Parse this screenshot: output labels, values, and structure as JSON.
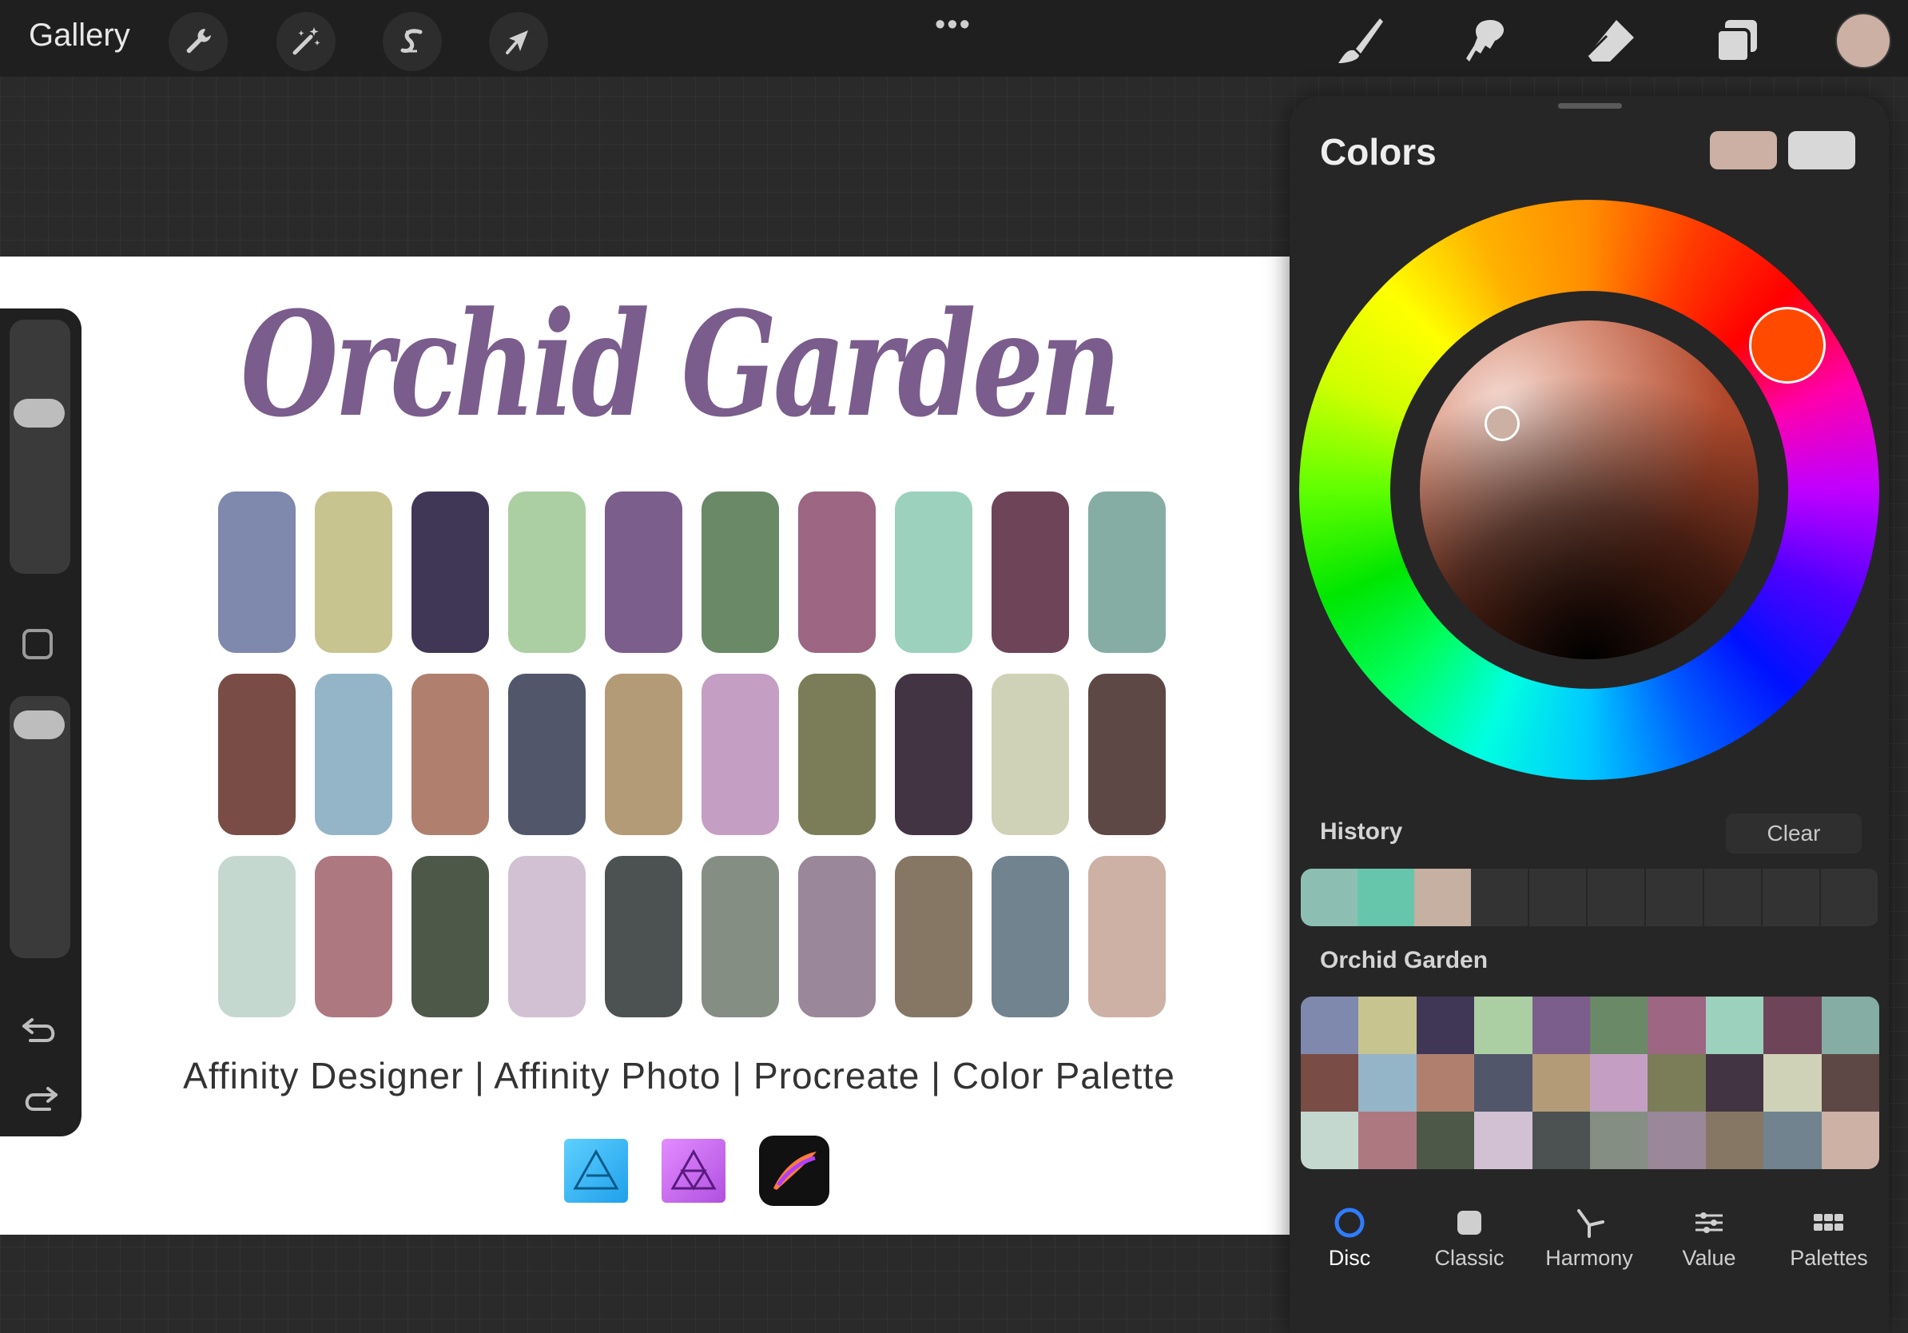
{
  "topbar": {
    "gallery_label": "Gallery",
    "tools_left": [
      "wrench-icon",
      "magic-wand-icon",
      "selection-s-icon",
      "transform-arrow-icon"
    ],
    "more_label": "•••",
    "tools_right": [
      "brush-icon",
      "smudge-icon",
      "eraser-icon",
      "layers-icon"
    ],
    "current_color": "#cbb0a3"
  },
  "canvas": {
    "title": "Orchid Garden",
    "title_color": "#7a5d8c",
    "swatch_rows": [
      [
        "#7f89ad",
        "#c7c490",
        "#403656",
        "#abcfa3",
        "#7b5e8b",
        "#698967",
        "#9d6683",
        "#9cd1bd",
        "#6e4558",
        "#85ada4"
      ],
      [
        "#794c46",
        "#94b5c7",
        "#b07f6e",
        "#51566a",
        "#b39b77",
        "#c49fc3",
        "#7b7d58",
        "#433443",
        "#d0d2b7",
        "#5d4846"
      ],
      [
        "#c5d8d0",
        "#ae7881",
        "#4d5849",
        "#d1c1d2",
        "#4c5251",
        "#848e83",
        "#9a8799",
        "#867765",
        "#70838e",
        "#cdb1a5"
      ]
    ],
    "tagline": "Affinity Designer | Affinity Photo | Procreate | Color Palette",
    "app_icons": [
      "affinity-designer-logo",
      "affinity-photo-logo",
      "procreate-logo"
    ]
  },
  "sidebar": {
    "brush_size_level": 0.28,
    "opacity_level": 0.92
  },
  "colors_panel": {
    "title": "Colors",
    "primary_color": "#cbb0a3",
    "secondary_color": "#d8d8d8",
    "hue_color": "#ff4a00",
    "history_label": "History",
    "clear_label": "Clear",
    "history_colors": [
      "#8cbfb2",
      "#66c6ac",
      "#c5b0a1"
    ],
    "history_empty_slots": 7,
    "palette_name": "Orchid Garden",
    "palette_colors": [
      "#7f89ad",
      "#c7c490",
      "#403656",
      "#abcfa3",
      "#7b5e8b",
      "#698967",
      "#9d6683",
      "#9cd1bd",
      "#6e4558",
      "#85ada4",
      "#794c46",
      "#94b5c7",
      "#b07f6e",
      "#51566a",
      "#b39b77",
      "#c49fc3",
      "#7b7d58",
      "#433443",
      "#d0d2b7",
      "#5d4846",
      "#c5d8d0",
      "#ae7881",
      "#4d5849",
      "#d1c1d2",
      "#4c5251",
      "#848e83",
      "#9a8799",
      "#867765",
      "#70838e",
      "#cdb1a5"
    ],
    "tabs": [
      {
        "label": "Disc",
        "icon": "disc-icon",
        "active": true
      },
      {
        "label": "Classic",
        "icon": "classic-square-icon",
        "active": false
      },
      {
        "label": "Harmony",
        "icon": "harmony-icon",
        "active": false
      },
      {
        "label": "Value",
        "icon": "sliders-icon",
        "active": false
      },
      {
        "label": "Palettes",
        "icon": "palette-grid-icon",
        "active": false
      }
    ]
  }
}
